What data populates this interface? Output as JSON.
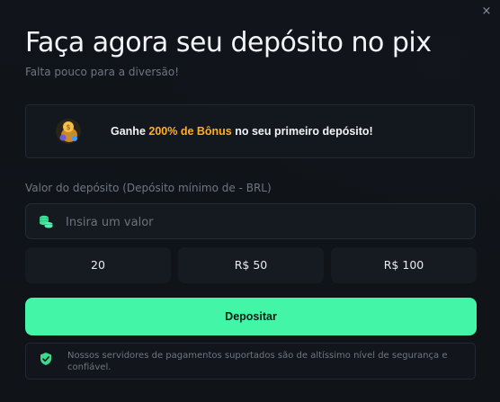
{
  "modal": {
    "title": "Faça agora seu depósito no pix",
    "subtitle": "Falta pouco para a diversão!",
    "close_label": "×"
  },
  "bonus": {
    "prefix": "Ganhe ",
    "highlight": "200% de Bônus",
    "suffix": " no seu primeiro depósito!",
    "icon": "coins-bag-icon",
    "highlight_color": "#ffb020"
  },
  "deposit_field": {
    "label": "Valor do depósito (Depósito mínimo de - BRL)",
    "placeholder": "Insira um valor",
    "value": "",
    "icon": "money-icon"
  },
  "quick_amounts": [
    "20",
    "R$ 50",
    "R$ 100"
  ],
  "actions": {
    "deposit_label": "Depositar",
    "accent_color": "#42f5a7"
  },
  "security": {
    "icon": "shield-check-icon",
    "text": "Nossos servidores de pagamentos suportados são de altíssimo nível de segurança e confiável."
  }
}
